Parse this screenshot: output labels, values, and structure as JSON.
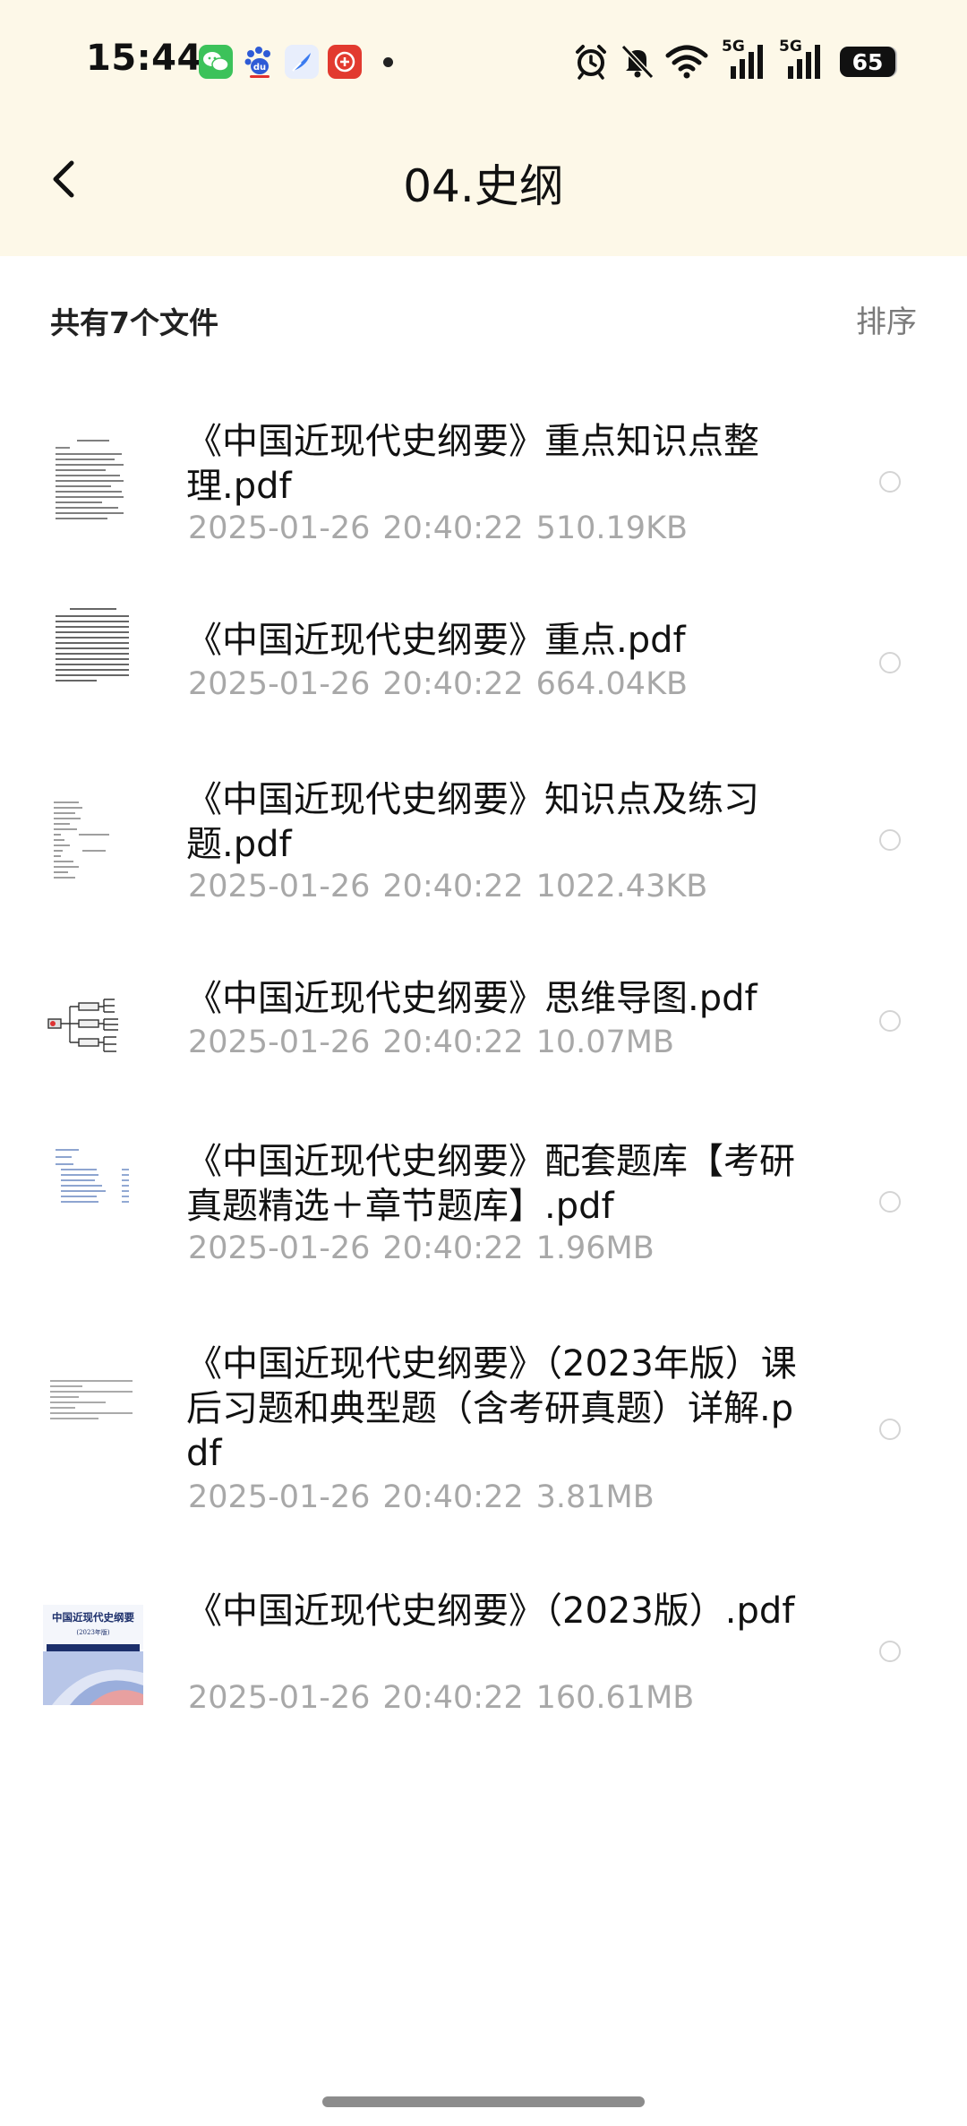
{
  "status_bar": {
    "time": "15:44",
    "battery": "65",
    "notification_apps": [
      "wechat-icon",
      "baidu-icon",
      "feather-app-icon",
      "gift-app-icon"
    ],
    "signal_label_1": "5G",
    "signal_label_2": "5G"
  },
  "header": {
    "title": "04.史纲",
    "background_color": "#fdf8e8"
  },
  "summary": {
    "file_count_label": "共有7个文件",
    "sort_label": "排序"
  },
  "files": [
    {
      "name": "《中国近现代史纲要》重点知识点整理.pdf",
      "date": "2025-01-26",
      "time": "20:40:22",
      "size": "510.19KB",
      "thumbnail": "text-document-thumbnail"
    },
    {
      "name": "《中国近现代史纲要》重点.pdf",
      "date": "2025-01-26",
      "time": "20:40:22",
      "size": "664.04KB",
      "thumbnail": "dense-text-thumbnail"
    },
    {
      "name": "《中国近现代史纲要》知识点及练习题.pdf",
      "date": "2025-01-26",
      "time": "20:40:22",
      "size": "1022.43KB",
      "thumbnail": "outline-text-thumbnail"
    },
    {
      "name": "《中国近现代史纲要》思维导图.pdf",
      "date": "2025-01-26",
      "time": "20:40:22",
      "size": "10.07MB",
      "thumbnail": "mind-map-thumbnail"
    },
    {
      "name": "《中国近现代史纲要》配套题库【考研真题精选＋章节题库】.pdf",
      "date": "2025-01-26",
      "time": "20:40:22",
      "size": "1.96MB",
      "thumbnail": "table-of-contents-thumbnail"
    },
    {
      "name": "《中国近现代史纲要》（2023年版）课后习题和典型题（含考研真题）详解.pdf",
      "date": "2025-01-26",
      "time": "20:40:22",
      "size": "3.81MB",
      "thumbnail": "sparse-text-thumbnail"
    },
    {
      "name": "《中国近现代史纲要》（2023版）.pdf",
      "date": "2025-01-26",
      "time": "20:40:22",
      "size": "160.61MB",
      "thumbnail": "book-cover-thumbnail",
      "cover_title": "中国近现代史纲要",
      "cover_subtitle": "(2023年版)"
    }
  ]
}
